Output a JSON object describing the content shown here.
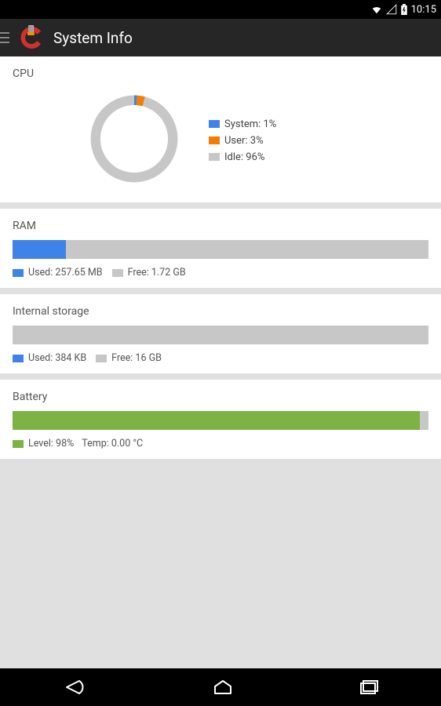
{
  "status": {
    "time": "10:15"
  },
  "app": {
    "title": "System Info"
  },
  "cpu": {
    "title": "CPU",
    "system": {
      "label": "System: 1%",
      "pct": 1,
      "color": "#3f83e8"
    },
    "user": {
      "label": "User: 3%",
      "pct": 3,
      "color": "#f57c00"
    },
    "idle": {
      "label": "Idle: 96%",
      "pct": 96,
      "color": "#c7c7c7"
    }
  },
  "ram": {
    "title": "RAM",
    "used": {
      "label": "Used: 257.65 MB",
      "bytes": 270187724
    },
    "free": {
      "label": "Free: 1.72 GB",
      "bytes": 1846835937
    },
    "fill_pct": 12.8
  },
  "storage": {
    "title": "Internal storage",
    "used": {
      "label": "Used: 384 KB",
      "bytes": 393216
    },
    "free": {
      "label": "Free: 16 GB",
      "bytes": 17179869184
    },
    "fill_pct": 0.0
  },
  "battery": {
    "title": "Battery",
    "level": {
      "label": "Level: 98%",
      "pct": 98
    },
    "temp": {
      "label": "Temp: 0.00 °C",
      "celsius": 0.0
    },
    "fill_pct": 98
  },
  "chart_data": {
    "type": "pie",
    "title": "CPU",
    "series": [
      {
        "name": "System",
        "value": 1,
        "color": "#3f83e8"
      },
      {
        "name": "User",
        "value": 3,
        "color": "#f57c00"
      },
      {
        "name": "Idle",
        "value": 96,
        "color": "#c7c7c7"
      }
    ]
  }
}
